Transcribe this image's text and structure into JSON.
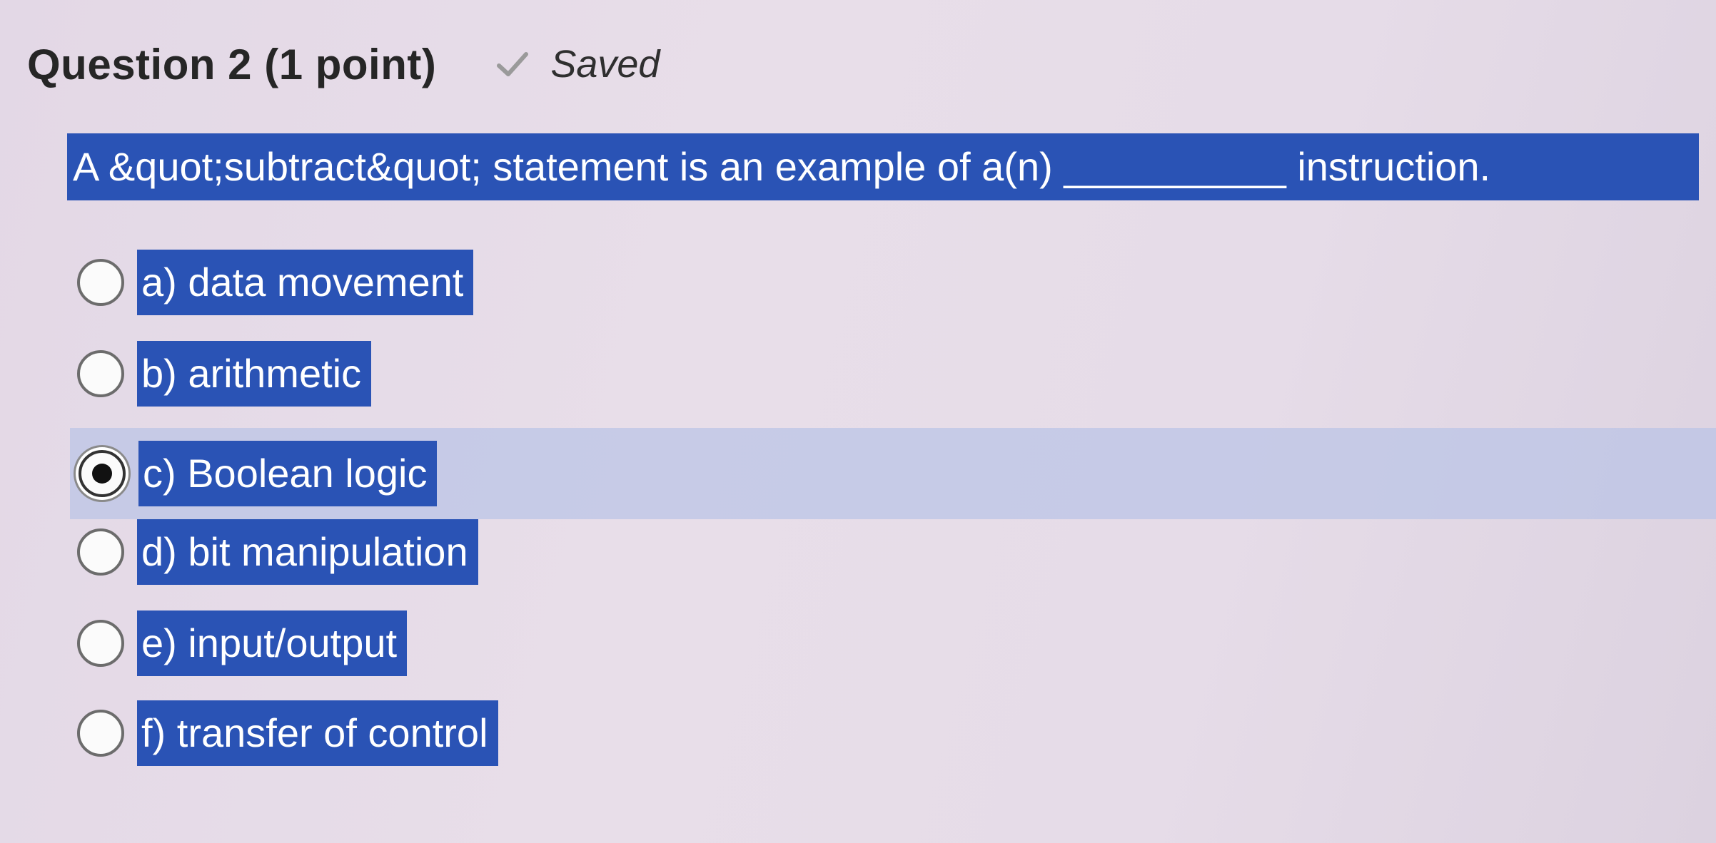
{
  "question": {
    "title": "Question 2 (1 point)",
    "saved_label": "Saved",
    "text": "A &quot;subtract&quot; statement is an example of a(n) __________ instruction."
  },
  "options": [
    {
      "label": "a) data movement",
      "selected": false
    },
    {
      "label": "b) arithmetic",
      "selected": false
    },
    {
      "label": "c) Boolean logic",
      "selected": true
    },
    {
      "label": "d) bit manipulation",
      "selected": false
    },
    {
      "label": "e) input/output",
      "selected": false
    },
    {
      "label": "f) transfer of control",
      "selected": false
    }
  ],
  "icons": {
    "saved": "checkmark-icon",
    "option": "radio-button"
  },
  "colors": {
    "highlight": "#2a53b5",
    "selected_row": "#bac4e6",
    "background": "#e6dce8"
  }
}
